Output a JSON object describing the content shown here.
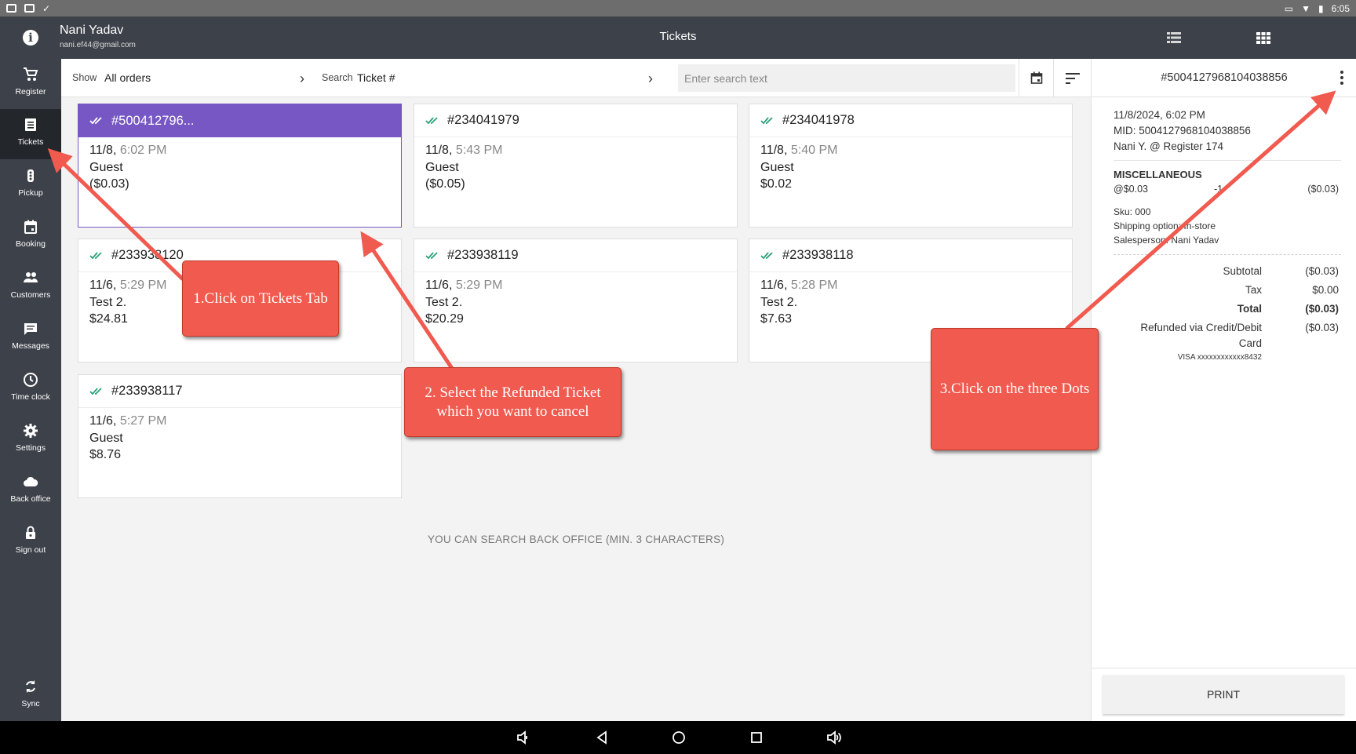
{
  "status_bar": {
    "time": "6:05"
  },
  "header": {
    "user_name": "Nani Yadav",
    "user_email": "nani.ef44@gmail.com",
    "title": "Tickets",
    "icons": [
      "info-icon",
      "list-view-icon",
      "grid-view-icon"
    ]
  },
  "sidebar": {
    "items": [
      {
        "label": "Register",
        "icon": "cart-icon"
      },
      {
        "label": "Tickets",
        "icon": "receipt-icon",
        "active": true
      },
      {
        "label": "Pickup",
        "icon": "pickup-icon"
      },
      {
        "label": "Booking",
        "icon": "calendar-icon"
      },
      {
        "label": "Customers",
        "icon": "people-icon"
      },
      {
        "label": "Messages",
        "icon": "message-icon"
      },
      {
        "label": "Time clock",
        "icon": "clock-icon"
      },
      {
        "label": "Settings",
        "icon": "gear-icon"
      },
      {
        "label": "Back office",
        "icon": "cloud-icon"
      },
      {
        "label": "Sign out",
        "icon": "lock-icon"
      },
      {
        "label": "Sync",
        "icon": "sync-icon"
      }
    ]
  },
  "toolbar": {
    "show_label": "Show",
    "show_value": "All orders",
    "search_label": "Search",
    "search_value": "Ticket #",
    "search_placeholder": "Enter search text"
  },
  "tickets": [
    {
      "number": "#500412796...",
      "date": "11/8,",
      "time": "6:02 PM",
      "customer": "Guest",
      "amount": "($0.03)",
      "selected": true
    },
    {
      "number": "#234041979",
      "date": "11/8,",
      "time": "5:43 PM",
      "customer": "Guest",
      "amount": "($0.05)"
    },
    {
      "number": "#234041978",
      "date": "11/8,",
      "time": "5:40 PM",
      "customer": "Guest",
      "amount": "$0.02"
    },
    {
      "number": "#233938120",
      "date": "11/6,",
      "time": "5:29 PM",
      "customer": "Test 2.",
      "amount": "$24.81"
    },
    {
      "number": "#233938119",
      "date": "11/6,",
      "time": "5:29 PM",
      "customer": "Test 2.",
      "amount": "$20.29"
    },
    {
      "number": "#233938118",
      "date": "11/6,",
      "time": "5:28 PM",
      "customer": "Test 2.",
      "amount": "$7.63"
    },
    {
      "number": "#233938117",
      "date": "11/6,",
      "time": "5:27 PM",
      "customer": "Guest",
      "amount": "$8.76"
    }
  ],
  "search_hint": "YOU CAN SEARCH BACK OFFICE (MIN. 3 CHARACTERS)",
  "detail": {
    "ticket_id": "#5004127968104038856",
    "datetime": "11/8/2024, 6:02 PM",
    "mid": "MID: 5004127968104038856",
    "register": "Nani Y. @ Register 174",
    "item_name": "MISCELLANEOUS",
    "item_price": "@$0.03",
    "item_qty": "-1",
    "item_total": "($0.03)",
    "sku": "Sku: 000",
    "shipping": "Shipping option: In-store",
    "salesperson": "Salesperson: Nani Yadav",
    "subtotal_label": "Subtotal",
    "subtotal_value": "($0.03)",
    "tax_label": "Tax",
    "tax_value": "$0.00",
    "total_label": "Total",
    "total_value": "($0.03)",
    "refund_label_1": "Refunded via Credit/Debit",
    "refund_label_2": "Card",
    "refund_value": "($0.03)",
    "card_number": "VISA xxxxxxxxxxxx8432",
    "print_label": "PRINT"
  },
  "annotations": [
    {
      "text": "1.Click on Tickets Tab"
    },
    {
      "text": "2. Select the Refunded Ticket which you want to cancel"
    },
    {
      "text": "3.Click on the three Dots"
    }
  ],
  "colors": {
    "sidebar": "#3d4149",
    "selected_ticket": "#7757c4",
    "check": "#2aa27a",
    "callout": "#f05a4f"
  }
}
